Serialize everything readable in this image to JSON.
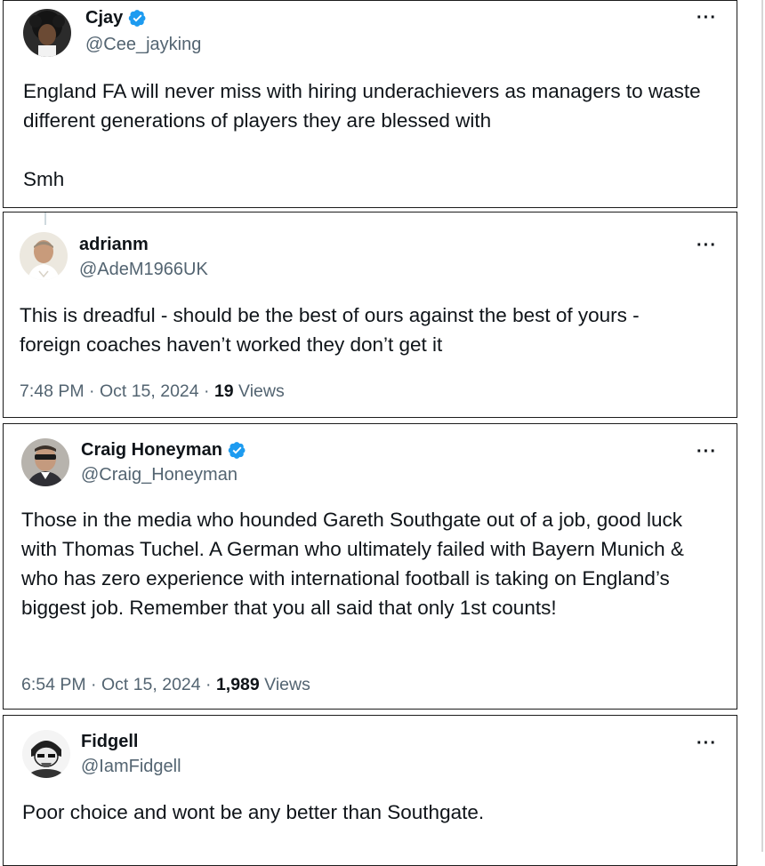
{
  "tweets": [
    {
      "display_name": "Cjay",
      "verified": true,
      "handle": "@Cee_jayking",
      "text": "England FA will never miss with hiring underachievers as managers to waste different generations of players they are blessed with\n\nSmh",
      "more_label": "···"
    },
    {
      "display_name": "adrianm",
      "verified": false,
      "handle": "@AdeM1966UK",
      "text": "This is dreadful - should be the best of ours against the best of yours - foreign coaches haven’t worked they don’t get it",
      "time": "7:48 PM · Oct 15, 2024 · ",
      "views_count": "19",
      "views_label": " Views",
      "more_label": "···"
    },
    {
      "display_name": "Craig Honeyman",
      "verified": true,
      "handle": "@Craig_Honeyman",
      "text": "Those in the media who hounded Gareth Southgate out of a job, good luck with Thomas Tuchel. A German who ultimately failed with Bayern Munich & who has zero experience with international football is taking on England’s biggest job. Remember that you all said that only 1st counts!",
      "time": "6:54 PM · Oct 15, 2024 · ",
      "views_count": "1,989",
      "views_label": " Views",
      "more_label": "···"
    },
    {
      "display_name": "Fidgell",
      "verified": false,
      "handle": "@IamFidgell",
      "text": "Poor choice and wont be any better than Southgate.",
      "more_label": "···"
    }
  ],
  "colors": {
    "text_primary": "#0f1419",
    "text_secondary": "#536471",
    "verified_blue": "#1d9bf0",
    "border": "#1c1c1c"
  },
  "icons": {
    "verified": "verified-badge-icon",
    "more": "more-options-icon"
  }
}
